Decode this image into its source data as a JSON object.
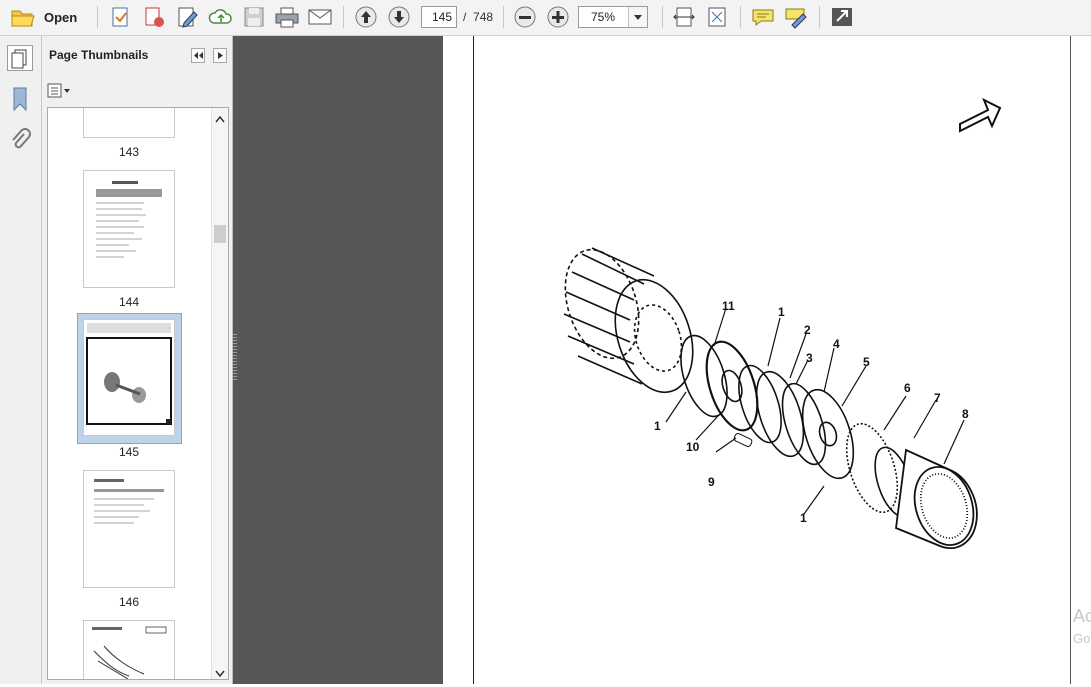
{
  "toolbar": {
    "open_label": "Open",
    "current_page": "145",
    "page_separator": "/",
    "total_pages": "748",
    "zoom": "75%"
  },
  "thumbnails_panel": {
    "title": "Page Thumbnails",
    "thumbnails": [
      {
        "label": "143"
      },
      {
        "label": "144"
      },
      {
        "label": "145",
        "selected": true
      },
      {
        "label": "146"
      }
    ]
  },
  "document": {
    "callouts": [
      "11",
      "1",
      "2",
      "3",
      "4",
      "5",
      "6",
      "7",
      "8",
      "9",
      "10",
      "1",
      "1"
    ],
    "watermark_line1": "Ac",
    "watermark_line2": "Go"
  }
}
